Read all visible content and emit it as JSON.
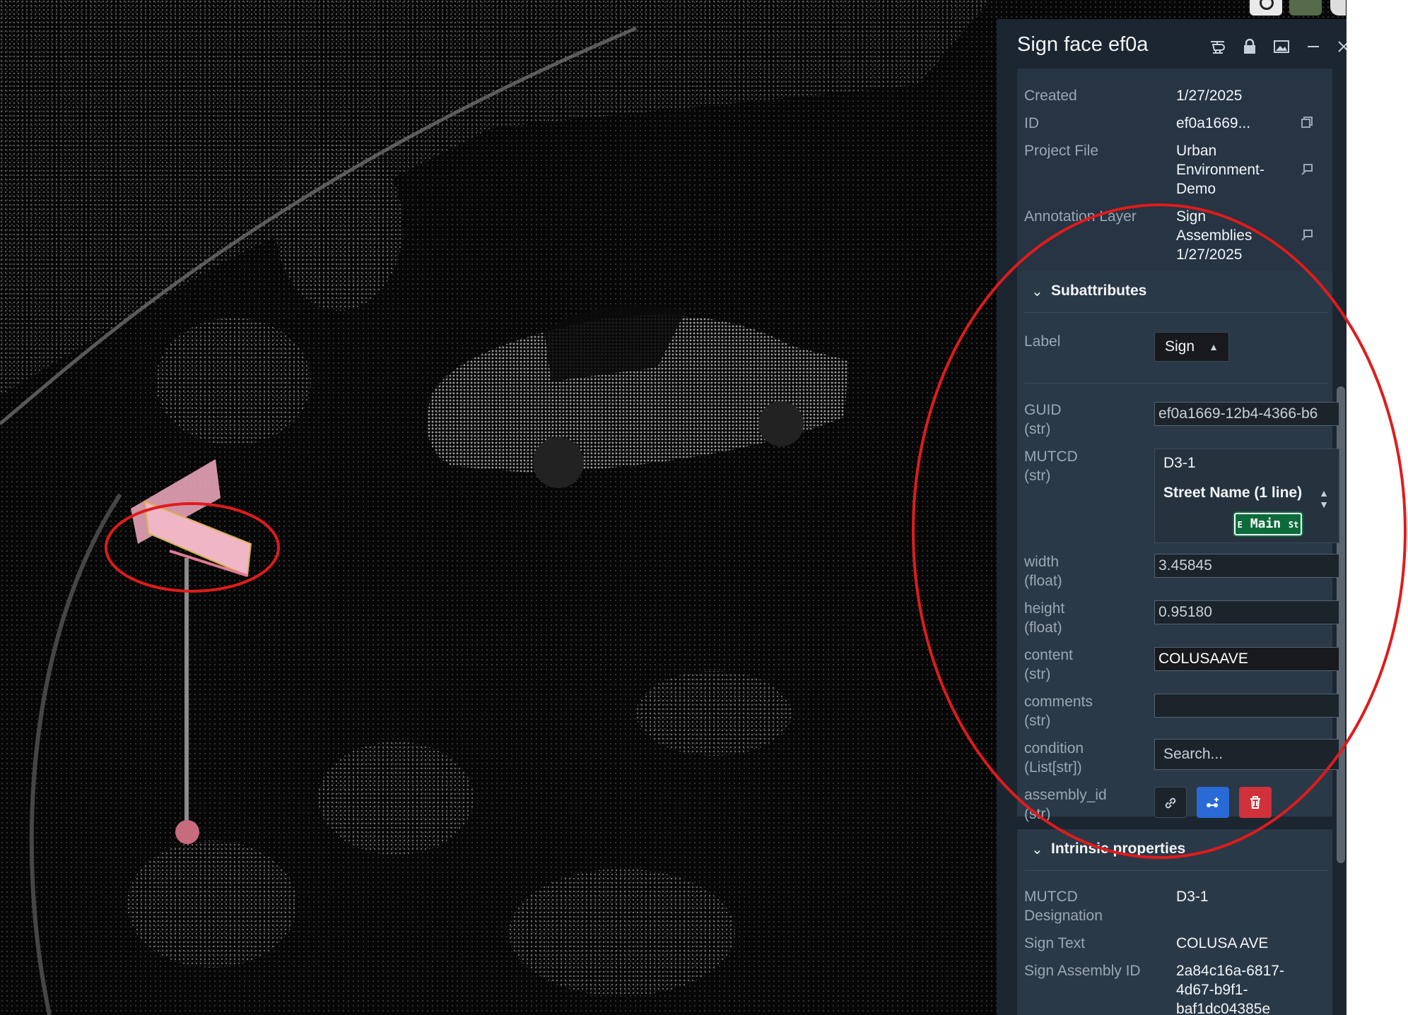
{
  "panel": {
    "title": "Sign face ef0a",
    "header_icons": [
      "helicopter-icon",
      "lock-icon",
      "image-icon",
      "minimize-icon",
      "close-icon"
    ]
  },
  "meta": {
    "created_label": "Created",
    "created_value": "1/27/2025",
    "id_label": "ID",
    "id_value": "ef0a1669...",
    "project_label": "Project File",
    "project_value_1": "Urban",
    "project_value_2": "Environment-",
    "project_value_3": "Demo",
    "layer_label": "Annotation Layer",
    "layer_value_1": "Sign",
    "layer_value_2": "Assemblies",
    "layer_value_3": "1/27/2025"
  },
  "subattributes": {
    "title": "Subattributes",
    "label_label": "Label",
    "label_value": "Sign",
    "guid_label_1": "GUID",
    "guid_label_2": "(str)",
    "guid_value": "ef0a1669-12b4-4366-b6",
    "mutcd_label_1": "MUTCD",
    "mutcd_label_2": "(str)",
    "mutcd_code": "D3-1",
    "mutcd_name": "Street Name (1 line)",
    "mutcd_sign_prefix": "E",
    "mutcd_sign_main": "Main",
    "mutcd_sign_suffix": "St",
    "width_label_1": "width",
    "width_label_2": "(float)",
    "width_value": "3.45845",
    "height_label_1": "height",
    "height_label_2": "(float)",
    "height_value": "0.95180",
    "content_label_1": "content",
    "content_label_2": "(str)",
    "content_value": "COLUSAAVE",
    "comments_label_1": "comments",
    "comments_label_2": "(str)",
    "comments_value": "",
    "condition_label_1": "condition",
    "condition_label_2": "(List[str])",
    "condition_placeholder": "Search...",
    "assembly_label_1": "assembly_id",
    "assembly_label_2": "(str)"
  },
  "intrinsic": {
    "title": "Intrinsic properties",
    "mutcd_label_1": "MUTCD",
    "mutcd_label_2": "Designation",
    "mutcd_value": "D3-1",
    "sign_text_label": "Sign Text",
    "sign_text_value": "COLUSA AVE",
    "assembly_label": "Sign Assembly ID",
    "assembly_value_1": "2a84c16a-6817-",
    "assembly_value_2": "4d67-b9f1-",
    "assembly_value_3": "baf1dc04385e"
  },
  "colors": {
    "panel_bg": "#1c2631",
    "section_bg": "#2a3947",
    "accent_blue": "#2a6ad6",
    "danger_red": "#d1313b",
    "annotation_red": "#e01b1b",
    "sign_green": "#0d6b3b",
    "sign_highlight": "#e8a3b8"
  }
}
